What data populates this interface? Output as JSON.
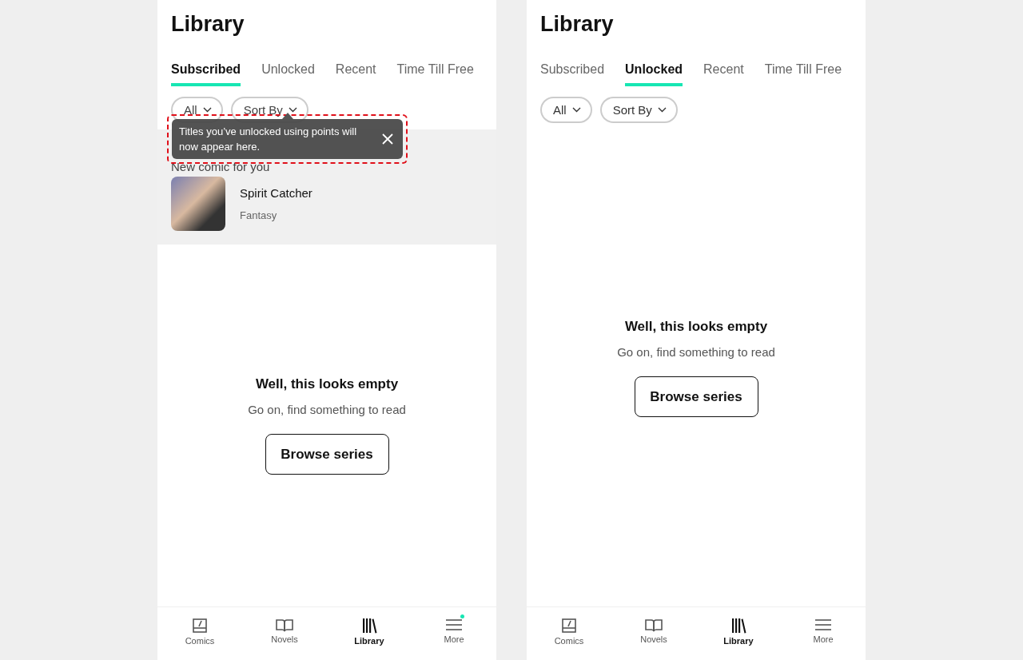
{
  "screens": [
    {
      "title": "Library",
      "tabs": [
        {
          "label": "Subscribed",
          "selected": true
        },
        {
          "label": "Unlocked",
          "selected": false
        },
        {
          "label": "Recent",
          "selected": false
        },
        {
          "label": "Time Till Free",
          "selected": false
        }
      ],
      "filters": [
        {
          "label": "All"
        },
        {
          "label": "Sort By"
        }
      ],
      "tooltip": {
        "text": "Titles you’ve unlocked using points will now appear here.",
        "highlighted": true
      },
      "recommendation": {
        "heading": "New comic for you",
        "title": "Spirit Catcher",
        "genre": "Fantasy"
      },
      "empty": {
        "title": "Well, this looks empty",
        "subtitle": "Go on, find something to read",
        "button": "Browse series"
      },
      "nav": [
        {
          "kind": "comics",
          "label": "Comics",
          "selected": false,
          "badge": false
        },
        {
          "kind": "novels",
          "label": "Novels",
          "selected": false,
          "badge": false
        },
        {
          "kind": "library",
          "label": "Library",
          "selected": true,
          "badge": false
        },
        {
          "kind": "more",
          "label": "More",
          "selected": false,
          "badge": true
        }
      ]
    },
    {
      "title": "Library",
      "tabs": [
        {
          "label": "Subscribed",
          "selected": false
        },
        {
          "label": "Unlocked",
          "selected": true
        },
        {
          "label": "Recent",
          "selected": false
        },
        {
          "label": "Time Till Free",
          "selected": false
        }
      ],
      "filters": [
        {
          "label": "All"
        },
        {
          "label": "Sort By"
        }
      ],
      "empty": {
        "title": "Well, this looks empty",
        "subtitle": "Go on, find something to read",
        "button": "Browse series"
      },
      "nav": [
        {
          "kind": "comics",
          "label": "Comics",
          "selected": false,
          "badge": false
        },
        {
          "kind": "novels",
          "label": "Novels",
          "selected": false,
          "badge": false
        },
        {
          "kind": "library",
          "label": "Library",
          "selected": true,
          "badge": false
        },
        {
          "kind": "more",
          "label": "More",
          "selected": false,
          "badge": false
        }
      ]
    }
  ]
}
